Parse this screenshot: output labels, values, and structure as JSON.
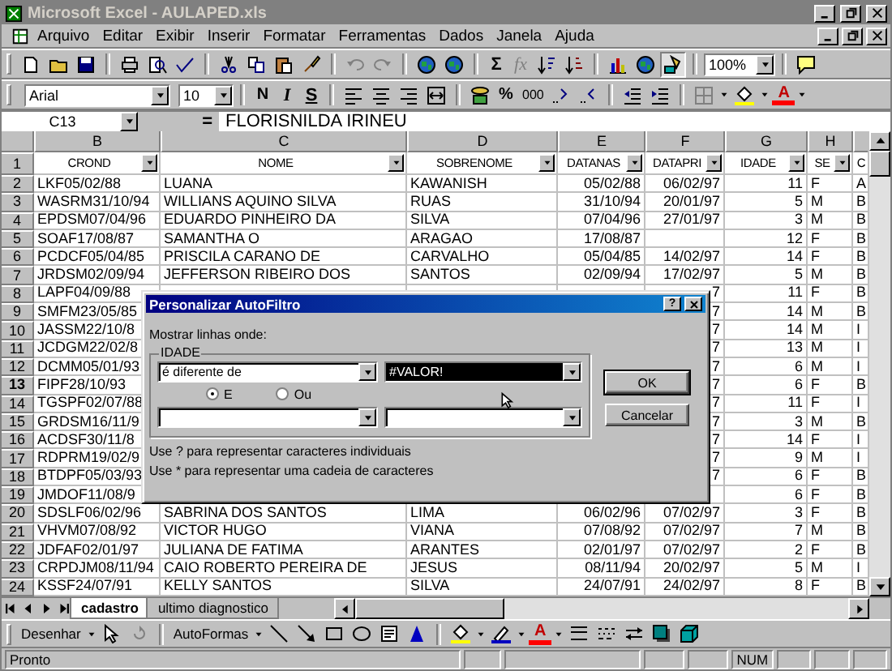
{
  "window": {
    "title": "Microsoft Excel - AULAPED.xls"
  },
  "menu": [
    "Arquivo",
    "Editar",
    "Exibir",
    "Inserir",
    "Formatar",
    "Ferramentas",
    "Dados",
    "Janela",
    "Ajuda"
  ],
  "standard_toolbar": {
    "sum": "Σ",
    "function": "fx",
    "zoom": "100%"
  },
  "formatting_toolbar": {
    "font": "Arial",
    "size": "10",
    "bold": "N",
    "italic": "I",
    "underline": "S",
    "percent": "%",
    "thousands": "000",
    "font_color": "A"
  },
  "formula_bar": {
    "name_box": "C13",
    "equals": "=",
    "value": "FLORISNILDA IRINEU"
  },
  "sheet": {
    "columns": [
      "B",
      "C",
      "D",
      "E",
      "F",
      "G",
      "H"
    ],
    "header_row": {
      "num": "1",
      "cells": [
        "CROND",
        "NOME",
        "SOBRENOME",
        "DATANAS",
        "DATAPRI",
        "IDADE",
        "SE",
        "C"
      ]
    },
    "rows": [
      {
        "num": "2",
        "active": false,
        "crond": "LKF05/02/88",
        "nome": "LUANA",
        "sobrenome": "KAWANISH",
        "datanas": "05/02/88",
        "datapri": "06/02/97",
        "idade": "11",
        "sexo": "F",
        "column_i": "A"
      },
      {
        "num": "3",
        "active": false,
        "crond": "WASRM31/10/94",
        "nome": "WILLIANS AQUINO SILVA",
        "sobrenome": "RUAS",
        "datanas": "31/10/94",
        "datapri": "20/01/97",
        "idade": "5",
        "sexo": "M",
        "column_i": "B"
      },
      {
        "num": "4",
        "active": false,
        "crond": "EPDSM07/04/96",
        "nome": "EDUARDO PINHEIRO DA",
        "sobrenome": "SILVA",
        "datanas": "07/04/96",
        "datapri": "27/01/97",
        "idade": "3",
        "sexo": "M",
        "column_i": "B"
      },
      {
        "num": "5",
        "active": false,
        "crond": "SOAF17/08/87",
        "nome": "SAMANTHA O",
        "sobrenome": "ARAGAO",
        "datanas": "17/08/87",
        "idade": "12",
        "sexo": "F",
        "column_i": "B"
      },
      {
        "num": "6",
        "active": false,
        "crond": "PCDCF05/04/85",
        "nome": "PRISCILA CARANO DE",
        "sobrenome": "CARVALHO",
        "datanas": "05/04/85",
        "datapri": "14/02/97",
        "idade": "14",
        "sexo": "F",
        "column_i": "B"
      },
      {
        "num": "7",
        "active": false,
        "crond": "JRDSM02/09/94",
        "nome": "JEFFERSON RIBEIRO DOS",
        "sobrenome": "SANTOS",
        "datanas": "02/09/94",
        "datapri": "17/02/97",
        "idade": "5",
        "sexo": "M",
        "column_i": "B"
      },
      {
        "num": "8",
        "active": false,
        "crond": "LAPF04/09/88",
        "datapri": "7",
        "idade": "11",
        "sexo": "F",
        "column_i": "B"
      },
      {
        "num": "9",
        "active": false,
        "crond": "SMFM23/05/85",
        "datapri": "7",
        "idade": "14",
        "sexo": "M",
        "column_i": "B"
      },
      {
        "num": "10",
        "active": false,
        "crond": "JASSM22/10/8",
        "datapri": "7",
        "idade": "14",
        "sexo": "M",
        "column_i": "I"
      },
      {
        "num": "11",
        "active": false,
        "crond": "JCDGM22/02/8",
        "datapri": "7",
        "idade": "13",
        "sexo": "M",
        "column_i": "I"
      },
      {
        "num": "12",
        "active": false,
        "crond": "DCMM05/01/93",
        "datapri": "7",
        "idade": "6",
        "sexo": "M",
        "column_i": "I"
      },
      {
        "num": "13",
        "active": true,
        "crond": "FIPF28/10/93",
        "datapri": "7",
        "idade": "6",
        "sexo": "F",
        "column_i": "B"
      },
      {
        "num": "14",
        "active": false,
        "crond": "TGSPF02/07/88",
        "datapri": "7",
        "idade": "11",
        "sexo": "F",
        "column_i": "I"
      },
      {
        "num": "15",
        "active": false,
        "crond": "GRDSM16/11/9",
        "datapri": "7",
        "idade": "3",
        "sexo": "M",
        "column_i": "B"
      },
      {
        "num": "16",
        "active": false,
        "crond": "ACDSF30/11/8",
        "datapri": "7",
        "idade": "14",
        "sexo": "F",
        "column_i": "I"
      },
      {
        "num": "17",
        "active": false,
        "crond": "RDPRM19/02/9",
        "datapri": "7",
        "idade": "9",
        "sexo": "M",
        "column_i": "I"
      },
      {
        "num": "18",
        "active": false,
        "crond": "BTDPF05/03/93",
        "datapri": "7",
        "idade": "6",
        "sexo": "F",
        "column_i": "B"
      },
      {
        "num": "19",
        "active": false,
        "crond": "JMDOF11/08/9",
        "idade": "6",
        "sexo": "F",
        "column_i": "B"
      },
      {
        "num": "20",
        "active": false,
        "crond": "SDSLF06/02/96",
        "nome": "SABRINA DOS SANTOS",
        "sobrenome": "LIMA",
        "datanas": "06/02/96",
        "datapri": "07/02/97",
        "idade": "3",
        "sexo": "F",
        "column_i": "B"
      },
      {
        "num": "21",
        "active": false,
        "crond": "VHVM07/08/92",
        "nome": "VICTOR HUGO",
        "sobrenome": "VIANA",
        "datanas": "07/08/92",
        "datapri": "07/02/97",
        "idade": "7",
        "sexo": "M",
        "column_i": "B"
      },
      {
        "num": "22",
        "active": false,
        "crond": "JDFAF02/01/97",
        "nome": "JULIANA DE FATIMA",
        "sobrenome": "ARANTES",
        "datanas": "02/01/97",
        "datapri": "07/02/97",
        "idade": "2",
        "sexo": "F",
        "column_i": "B"
      },
      {
        "num": "23",
        "active": false,
        "crond": "CRPDJM08/11/94",
        "nome": "CAIO ROBERTO PEREIRA DE",
        "sobrenome": "JESUS",
        "datanas": "08/11/94",
        "datapri": "20/02/97",
        "idade": "5",
        "sexo": "M",
        "column_i": "I"
      },
      {
        "num": "24",
        "active": false,
        "crond": "KSSF24/07/91",
        "nome": "KELLY SANTOS",
        "sobrenome": "SILVA",
        "datanas": "24/07/91",
        "datapri": "24/02/97",
        "idade": "8",
        "sexo": "F",
        "column_i": "B"
      }
    ]
  },
  "dialog": {
    "title": "Personalizar AutoFiltro",
    "help": "?",
    "prompt": "Mostrar linhas onde:",
    "field": "IDADE",
    "operator": "é diferente de",
    "value": "#VALOR!",
    "value_highlighted": true,
    "join": [
      {
        "label": "E",
        "selected": true
      },
      {
        "label": "Ou",
        "selected": false
      }
    ],
    "buttons": [
      "OK",
      "Cancelar"
    ],
    "hints": [
      "Use ? para representar caracteres individuais",
      "Use * para representar uma cadeia de caracteres"
    ]
  },
  "sheet_tabs": [
    {
      "label": "cadastro",
      "selected": true
    },
    {
      "label": "ultimo diagnostico",
      "selected": false
    }
  ],
  "drawing_toolbar": {
    "draw": "Desenhar",
    "autoshapes": "AutoFormas",
    "font_color": "A"
  },
  "status_bar": {
    "text": "Pronto",
    "indicator": "NUM"
  }
}
